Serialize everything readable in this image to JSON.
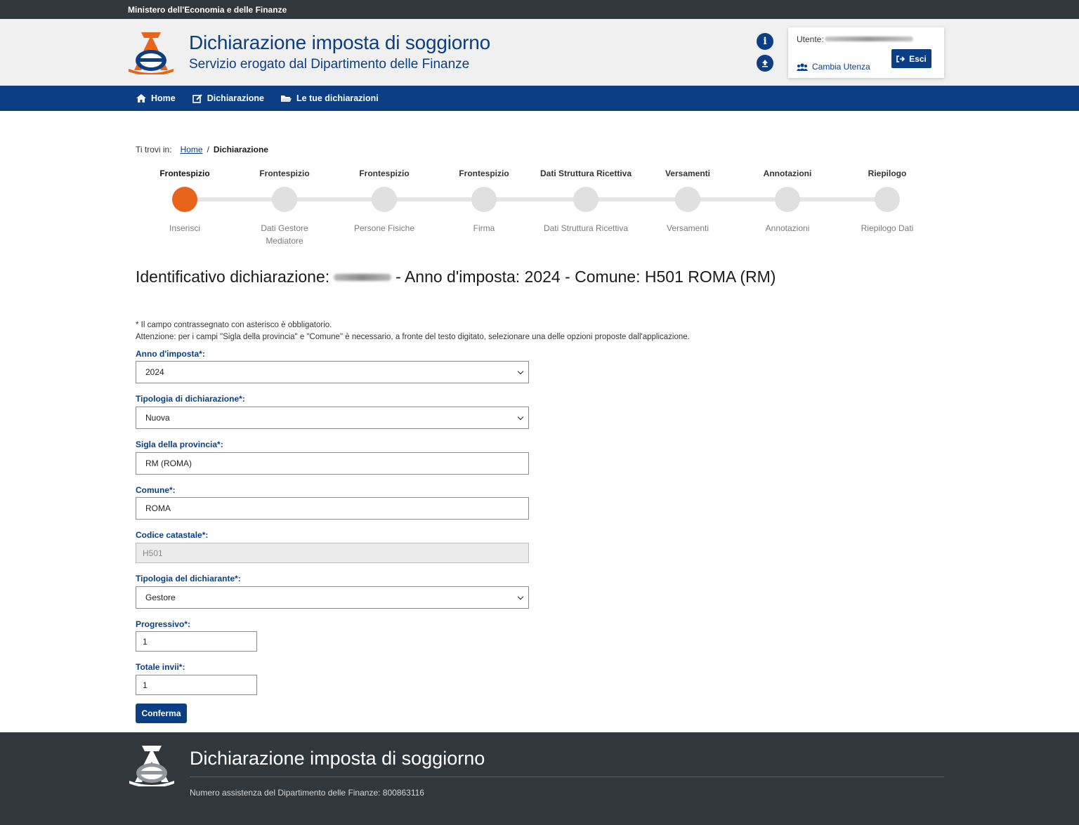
{
  "topbar": {
    "ministry": "Ministero dell'Economia e delle Finanze"
  },
  "header": {
    "title": "Dichiarazione imposta di soggiorno",
    "subtitle": "Servizio erogato dal Dipartimento delle Finanze",
    "info_icon": "info-icon",
    "upload_icon": "upload-icon",
    "user_label": "Utente:",
    "change_user": "Cambia Utenza",
    "logout": "Esci"
  },
  "nav": [
    {
      "label": "Home",
      "icon": "home-icon"
    },
    {
      "label": "Dichiarazione",
      "icon": "edit-icon"
    },
    {
      "label": "Le tue dichiarazioni",
      "icon": "folder-icon"
    }
  ],
  "breadcrumb": {
    "prefix": "Ti trovi in:",
    "home": "Home",
    "separator": "/",
    "current": "Dichiarazione"
  },
  "steps": [
    {
      "top": "Frontespizio",
      "bottom": "Inserisci",
      "active": true
    },
    {
      "top": "Frontespizio",
      "bottom": "Dati Gestore Mediatore",
      "active": false
    },
    {
      "top": "Frontespizio",
      "bottom": "Persone Fisiche",
      "active": false
    },
    {
      "top": "Frontespizio",
      "bottom": "Firma",
      "active": false
    },
    {
      "top": "Dati Struttura Ricettiva",
      "bottom": "Dati Struttura Ricettiva",
      "active": false
    },
    {
      "top": "Versamenti",
      "bottom": "Versamenti",
      "active": false
    },
    {
      "top": "Annotazioni",
      "bottom": "Annotazioni",
      "active": false
    },
    {
      "top": "Riepilogo",
      "bottom": "Riepilogo Dati",
      "active": false
    }
  ],
  "identifier": {
    "label": "Identificativo dichiarazione:",
    "rest": "- Anno d'imposta: 2024 - Comune: H501 ROMA (RM)"
  },
  "notes": {
    "required": "* Il campo contrassegnato con asterisco è obbligatorio.",
    "warning": "Attenzione: per i campi \"Sigla della provincia\" e \"Comune\" è necessario, a fronte del testo digitato, selezionare una delle opzioni proposte dall'applicazione."
  },
  "form": {
    "anno": {
      "label": "Anno d'imposta*:",
      "value": "2024"
    },
    "tipologia": {
      "label": "Tipologia di dichiarazione*:",
      "value": "Nuova"
    },
    "provincia": {
      "label": "Sigla della provincia*:",
      "value": "RM (ROMA)"
    },
    "comune": {
      "label": "Comune*:",
      "value": "ROMA"
    },
    "codice": {
      "label": "Codice catastale*:",
      "value": "H501"
    },
    "dichiarante": {
      "label": "Tipologia del dichiarante*:",
      "value": "Gestore"
    },
    "progressivo": {
      "label": "Progressivo*:",
      "value": "1"
    },
    "totale": {
      "label": "Totale invii*:",
      "value": "1"
    },
    "confirm": "Conferma"
  },
  "footer": {
    "title": "Dichiarazione imposta di soggiorno",
    "assistance": "Numero assistenza del Dipartimento delle Finanze: 800863116"
  },
  "colors": {
    "primary": "#0b3e83",
    "accent": "#e8641b",
    "dark": "#30373d"
  }
}
